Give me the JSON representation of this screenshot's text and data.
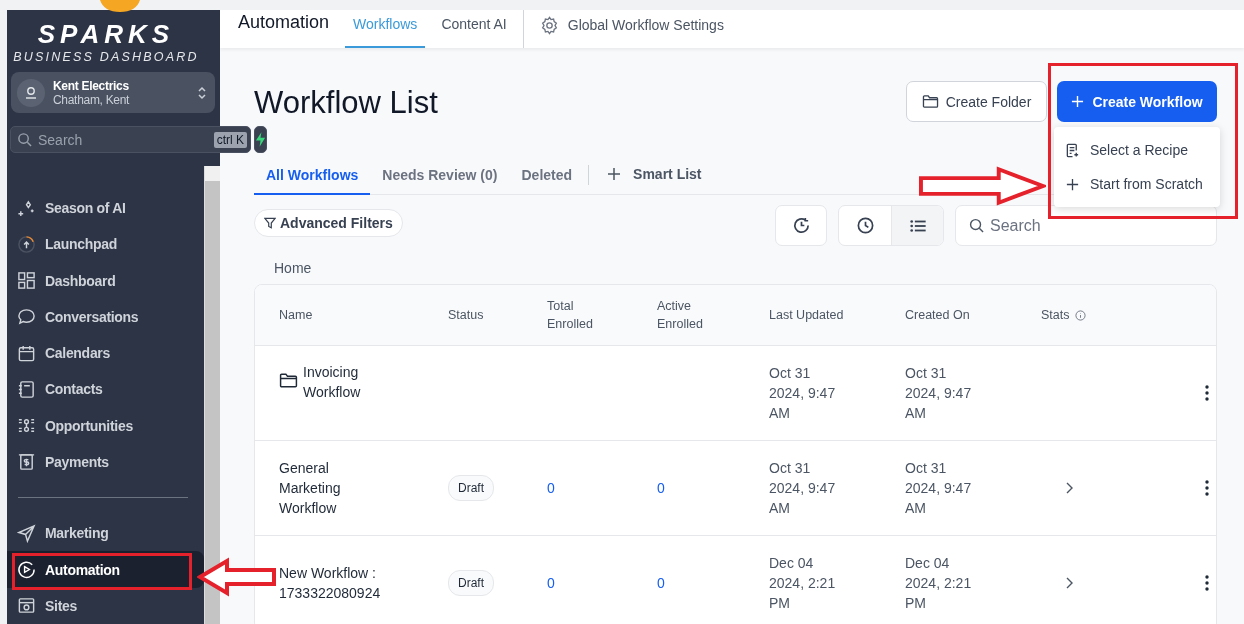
{
  "sidebar": {
    "brand": "SPARKS",
    "tagline": "BUSINESS DASHBOARD",
    "account": {
      "name": "Kent Electrics",
      "location": "Chatham, Kent"
    },
    "search": {
      "placeholder": "Search",
      "shortcut": "ctrl K"
    },
    "items": [
      {
        "label": "Season of AI",
        "selected": false
      },
      {
        "label": "Launchpad",
        "selected": false
      },
      {
        "label": "Dashboard",
        "selected": false
      },
      {
        "label": "Conversations",
        "selected": false
      },
      {
        "label": "Calendars",
        "selected": false
      },
      {
        "label": "Contacts",
        "selected": false
      },
      {
        "label": "Opportunities",
        "selected": false
      },
      {
        "label": "Payments",
        "selected": false
      },
      {
        "label": "Marketing",
        "selected": false
      },
      {
        "label": "Automation",
        "selected": true
      },
      {
        "label": "Sites",
        "selected": false
      }
    ]
  },
  "header": {
    "title": "Automation",
    "tabs": [
      {
        "label": "Workflows",
        "selected": true
      },
      {
        "label": "Content AI",
        "selected": false
      }
    ],
    "settings": "Global Workflow Settings"
  },
  "page": {
    "title": "Workflow List",
    "create_folder": "Create Folder",
    "create_workflow": "Create Workflow",
    "menu": [
      {
        "label": "Select a Recipe"
      },
      {
        "label": "Start from Scratch"
      }
    ],
    "tabs": [
      {
        "label": "All Workflows",
        "selected": true
      },
      {
        "label": "Needs Review (0)",
        "selected": false
      },
      {
        "label": "Deleted",
        "selected": false
      }
    ],
    "smart_list": "Smart List",
    "filters": "Advanced Filters",
    "search": {
      "placeholder": "Search"
    },
    "breadcrumb": "Home"
  },
  "table": {
    "columns": [
      "Name",
      "Status",
      "Total Enrolled",
      "Active Enrolled",
      "Last Updated",
      "Created On",
      "Stats"
    ],
    "rows": [
      {
        "kind": "folder",
        "name": "Invoicing Workflow",
        "updated": "Oct 31 2024, 9:47 AM",
        "created": "Oct 31 2024, 9:47 AM"
      },
      {
        "kind": "workflow",
        "name": "General Marketing Workflow",
        "status": "Draft",
        "total": "0",
        "active": "0",
        "updated": "Oct 31 2024, 9:47 AM",
        "created": "Oct 31 2024, 9:47 AM"
      },
      {
        "kind": "workflow",
        "name": "New Workflow : 1733322080924",
        "status": "Draft",
        "total": "0",
        "active": "0",
        "updated": "Dec 04 2024, 2:21 PM",
        "created": "Dec 04 2024, 2:21 PM"
      }
    ]
  }
}
